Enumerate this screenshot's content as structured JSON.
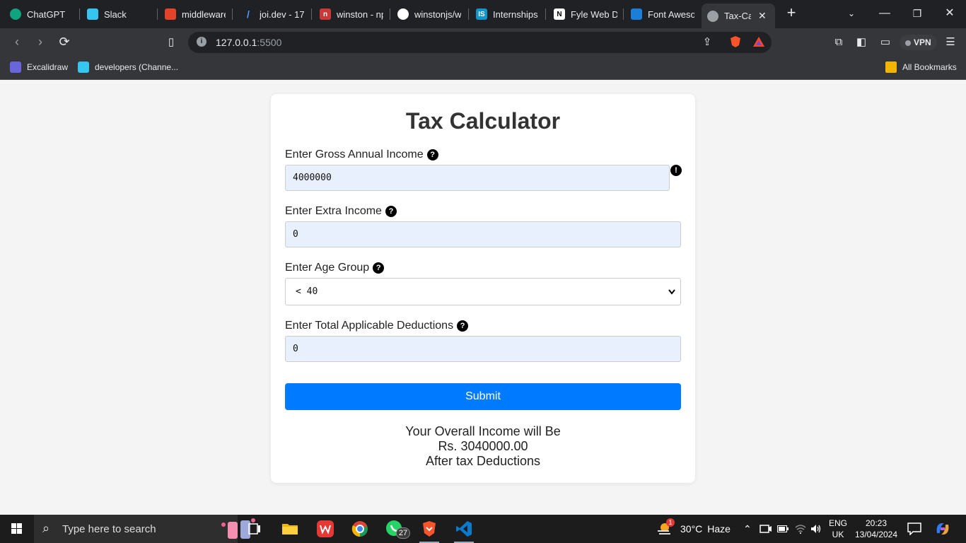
{
  "tabs": [
    {
      "label": "ChatGPT",
      "icon": "chatgpt-icon"
    },
    {
      "label": "Slack",
      "icon": "slack-icon"
    },
    {
      "label": "middleware",
      "icon": "gitlab-icon"
    },
    {
      "label": "joi.dev - 17.",
      "icon": "joi-icon"
    },
    {
      "label": "winston - np",
      "icon": "npm-icon"
    },
    {
      "label": "winstonjs/w",
      "icon": "github-icon"
    },
    {
      "label": "Internships |",
      "icon": "internshala-icon"
    },
    {
      "label": "Fyle Web De",
      "icon": "notion-icon"
    },
    {
      "label": "Font Aweso",
      "icon": "fontawesome-icon"
    },
    {
      "label": "Tax-Calc",
      "icon": "globe-icon"
    }
  ],
  "address": {
    "host": "127.0.0.1",
    "port": ":5500"
  },
  "vpn_label": "VPN",
  "bookmarks": {
    "items": [
      {
        "label": "Excalidraw"
      },
      {
        "label": "developers (Channe..."
      }
    ],
    "all_label": "All Bookmarks"
  },
  "form": {
    "title": "Tax Calculator",
    "gross_label": "Enter Gross Annual Income",
    "gross_value": "4000000",
    "extra_label": "Enter Extra Income",
    "extra_value": "0",
    "age_label": "Enter Age Group",
    "age_value": "< 40",
    "deductions_label": "Enter Total Applicable Deductions",
    "deductions_value": "0",
    "submit_label": "Submit",
    "help_glyph": "?",
    "error_glyph": "!"
  },
  "result": {
    "line1": "Your Overall Income will Be",
    "line2": "Rs. 3040000.00",
    "line3": "After tax Deductions"
  },
  "taskbar": {
    "search_placeholder": "Type here to search",
    "whatsapp_badge": "27",
    "weather_badge": "1",
    "weather_temp": "30°C",
    "weather_text": "Haze",
    "lang": "ENG",
    "region": "UK",
    "time": "20:23",
    "date": "13/04/2024"
  },
  "colors": {
    "accent": "#007bff",
    "input_bg": "#e8f0fe",
    "chrome_dark": "#202124",
    "chrome_toolbar": "#35363a"
  }
}
